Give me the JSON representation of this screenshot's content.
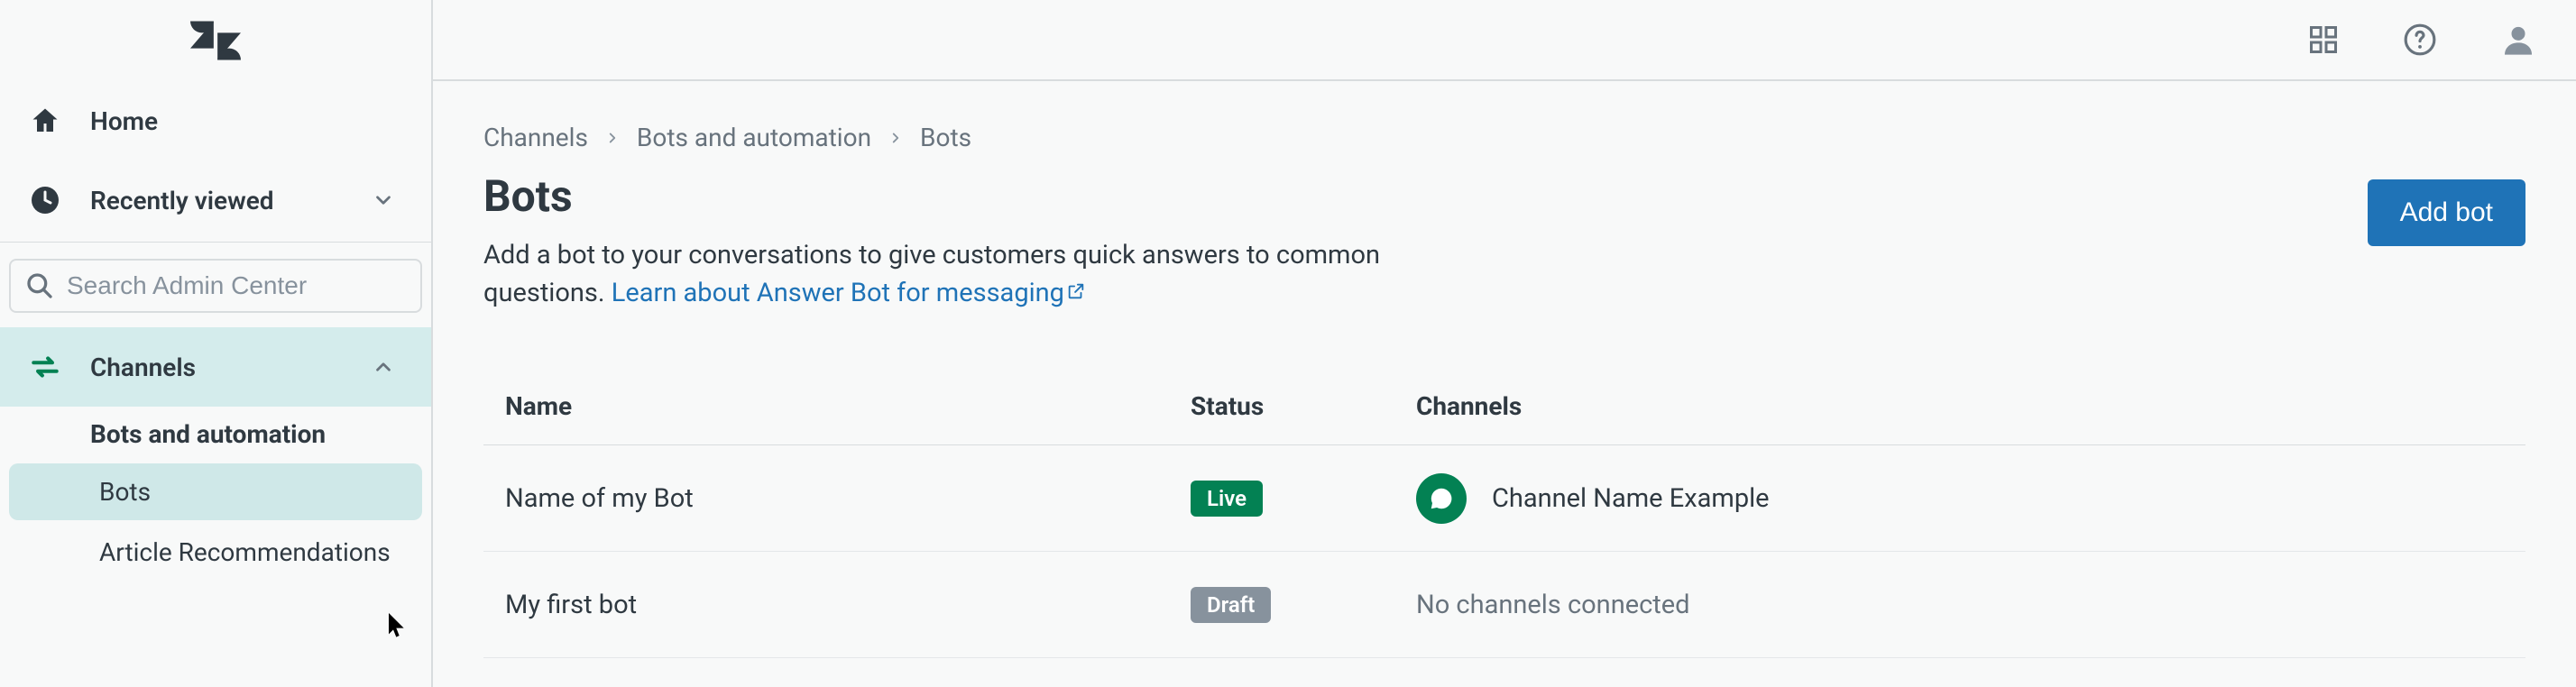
{
  "sidebar": {
    "home_label": "Home",
    "recent_label": "Recently viewed",
    "search_placeholder": "Search Admin Center",
    "channels_label": "Channels",
    "group_title": "Bots and automation",
    "item_bots": "Bots",
    "item_article": "Article Recommendations"
  },
  "breadcrumbs": [
    "Channels",
    "Bots and automation",
    "Bots"
  ],
  "page": {
    "title": "Bots",
    "desc_prefix": "Add a bot to your conversations to give customers quick answers to common questions. ",
    "desc_link": "Learn about Answer Bot for messaging"
  },
  "actions": {
    "add_bot": "Add bot"
  },
  "table": {
    "headers": {
      "name": "Name",
      "status": "Status",
      "channels": "Channels"
    },
    "rows": [
      {
        "name": "Name of my Bot",
        "status": "Live",
        "status_kind": "live",
        "channel_label": "Channel Name Example",
        "has_channel": true
      },
      {
        "name": "My first bot",
        "status": "Draft",
        "status_kind": "draft",
        "channel_label": "No channels connected",
        "has_channel": false
      }
    ]
  }
}
